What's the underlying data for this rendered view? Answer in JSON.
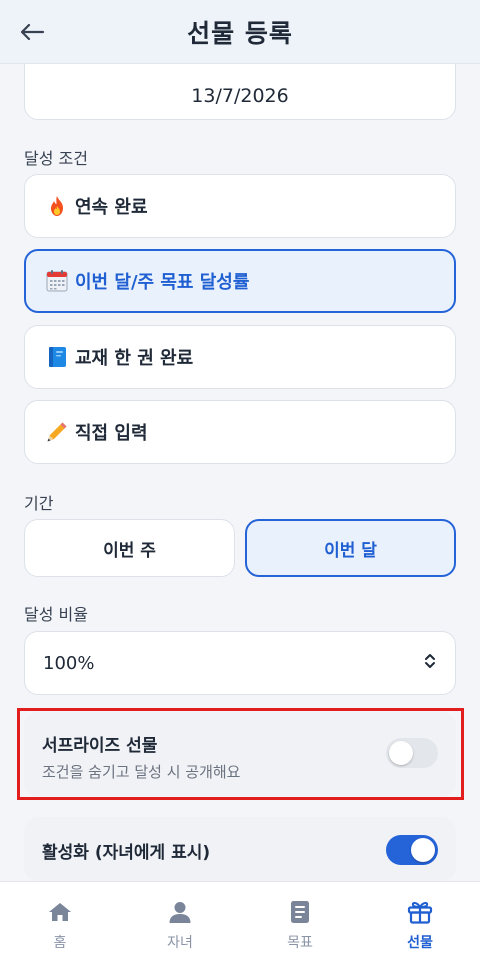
{
  "header": {
    "title": "선물 등록"
  },
  "date": {
    "value": "13/7/2026"
  },
  "condition": {
    "label": "달성 조건",
    "options": [
      {
        "label": "연속 완료",
        "icon": "fire-icon",
        "selected": false
      },
      {
        "label": "이번 달/주 목표 달성률",
        "icon": "calendar-icon",
        "selected": true
      },
      {
        "label": "교재 한 권 완료",
        "icon": "notebook-icon",
        "selected": false
      },
      {
        "label": "직접 입력",
        "icon": "pencil-icon",
        "selected": false
      }
    ]
  },
  "period": {
    "label": "기간",
    "week": "이번 주",
    "month": "이번 달",
    "selected": "이번 달"
  },
  "rate": {
    "label": "달성 비율",
    "value": "100%"
  },
  "surprise": {
    "title": "서프라이즈 선물",
    "subtitle": "조건을 숨기고 달성 시 공개해요",
    "enabled": false
  },
  "active": {
    "title": "활성화 (자녀에게 표시)",
    "enabled": true
  },
  "nav": {
    "items": [
      {
        "label": "홈",
        "icon": "home-icon",
        "active": false
      },
      {
        "label": "자녀",
        "icon": "person-icon",
        "active": false
      },
      {
        "label": "목표",
        "icon": "document-icon",
        "active": false
      },
      {
        "label": "선물",
        "icon": "gift-icon",
        "active": true
      }
    ]
  },
  "colors": {
    "accent": "#2563d8",
    "highlight": "#e11d1d"
  }
}
